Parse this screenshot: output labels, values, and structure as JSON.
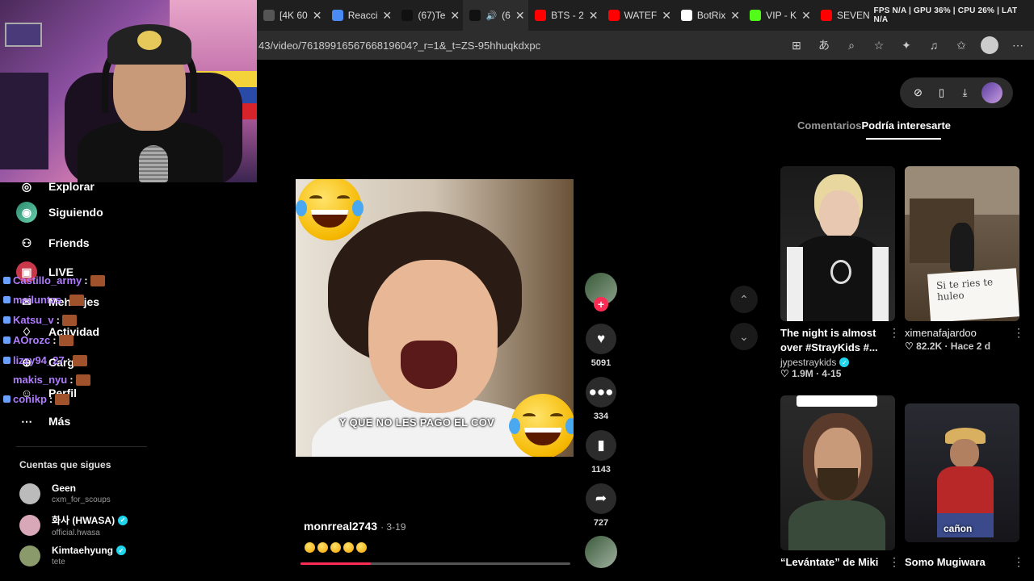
{
  "browser": {
    "tabs": [
      {
        "label": "[4K 60",
        "color": "#555"
      },
      {
        "label": "Reacci",
        "color": "#4a8af4"
      },
      {
        "label": "(67)Te",
        "color": "#111"
      },
      {
        "label": "(6",
        "color": "#111",
        "active": true
      },
      {
        "label": "BTS - 2",
        "color": "#ff0000"
      },
      {
        "label": "WATEF",
        "color": "#ff0000"
      },
      {
        "label": "BotRix",
        "color": "#fff"
      },
      {
        "label": "VIP - K",
        "color": "#53fc18"
      },
      {
        "label": "SEVEN",
        "color": "#ff0000"
      }
    ],
    "system_stats": "FPS N/A | GPU 36% | CPU 26% | LAT N/A",
    "url": "43/video/7618991656766819604?_r=1&_t=ZS-95hhuqkdxpc"
  },
  "sidebar": {
    "nav": [
      {
        "label": "Explorar",
        "icon": "compass-icon"
      },
      {
        "label": "Siguiendo",
        "icon": "following-icon"
      },
      {
        "label": "Friends",
        "icon": "friends-icon"
      },
      {
        "label": "LIVE",
        "icon": "live-icon"
      },
      {
        "label": "Mensajes",
        "icon": "message-icon"
      },
      {
        "label": "Actividad",
        "icon": "activity-icon"
      },
      {
        "label": "Cargar",
        "icon": "upload-icon"
      },
      {
        "label": "Perfil",
        "icon": "profile-icon"
      },
      {
        "label": "Más",
        "icon": "more-icon"
      }
    ],
    "following_title": "Cuentas que sigues",
    "accounts": [
      {
        "name": "Geen",
        "handle": "cxm_for_scoups",
        "verified": false
      },
      {
        "name": "화사 (HWASA)",
        "handle": "official.hwasa",
        "verified": true
      },
      {
        "name": "Kimtaehyung",
        "handle": "tete",
        "verified": true
      }
    ]
  },
  "chat": [
    {
      "user": "Castillo_army",
      "suffix": ":",
      "color": "#b07cff"
    },
    {
      "user": "meiluntzs",
      "suffix": ":",
      "color": "#b07cff"
    },
    {
      "user": "Katsu_v",
      "suffix": ":",
      "color": "#b07cff"
    },
    {
      "user": "AOrozc",
      "suffix": ":",
      "color": "#b07cff"
    },
    {
      "user": "lizzy94_27",
      "suffix": ":",
      "color": "#b07cff"
    },
    {
      "user": "makis_nyu",
      "suffix": ":",
      "color": "#b07cff"
    },
    {
      "user": "conikp",
      "suffix": ":",
      "color": "#b07cff"
    }
  ],
  "video": {
    "caption": "Y QUE NO LES PAGO EL COV",
    "author": "monrreal2743",
    "date": "· 3-19",
    "progress": 0.26
  },
  "actions": {
    "likes": "5091",
    "comments": "334",
    "saves": "1143",
    "shares": "727"
  },
  "right_panel": {
    "tab_comments": "Comentarios",
    "tab_interest": "Podría interesarte",
    "cards": [
      {
        "title": "The night is almost over #StrayKids #...",
        "author": "jypestraykids",
        "verified": true,
        "stats": "♡ 1.9M · 4-15"
      },
      {
        "title": "",
        "author": "",
        "verified": false,
        "stats": "♡ 82.2K · Hace 2 d",
        "author_inline": "ximenafajardoo",
        "note": "Si te ries te hulеo"
      },
      {
        "title": "“Levántate” de Miki",
        "author": "",
        "verified": false,
        "stats": ""
      },
      {
        "title": "Somo Mugiwara",
        "author": "",
        "verified": false,
        "stats": "",
        "overlay": "cañon"
      }
    ]
  }
}
